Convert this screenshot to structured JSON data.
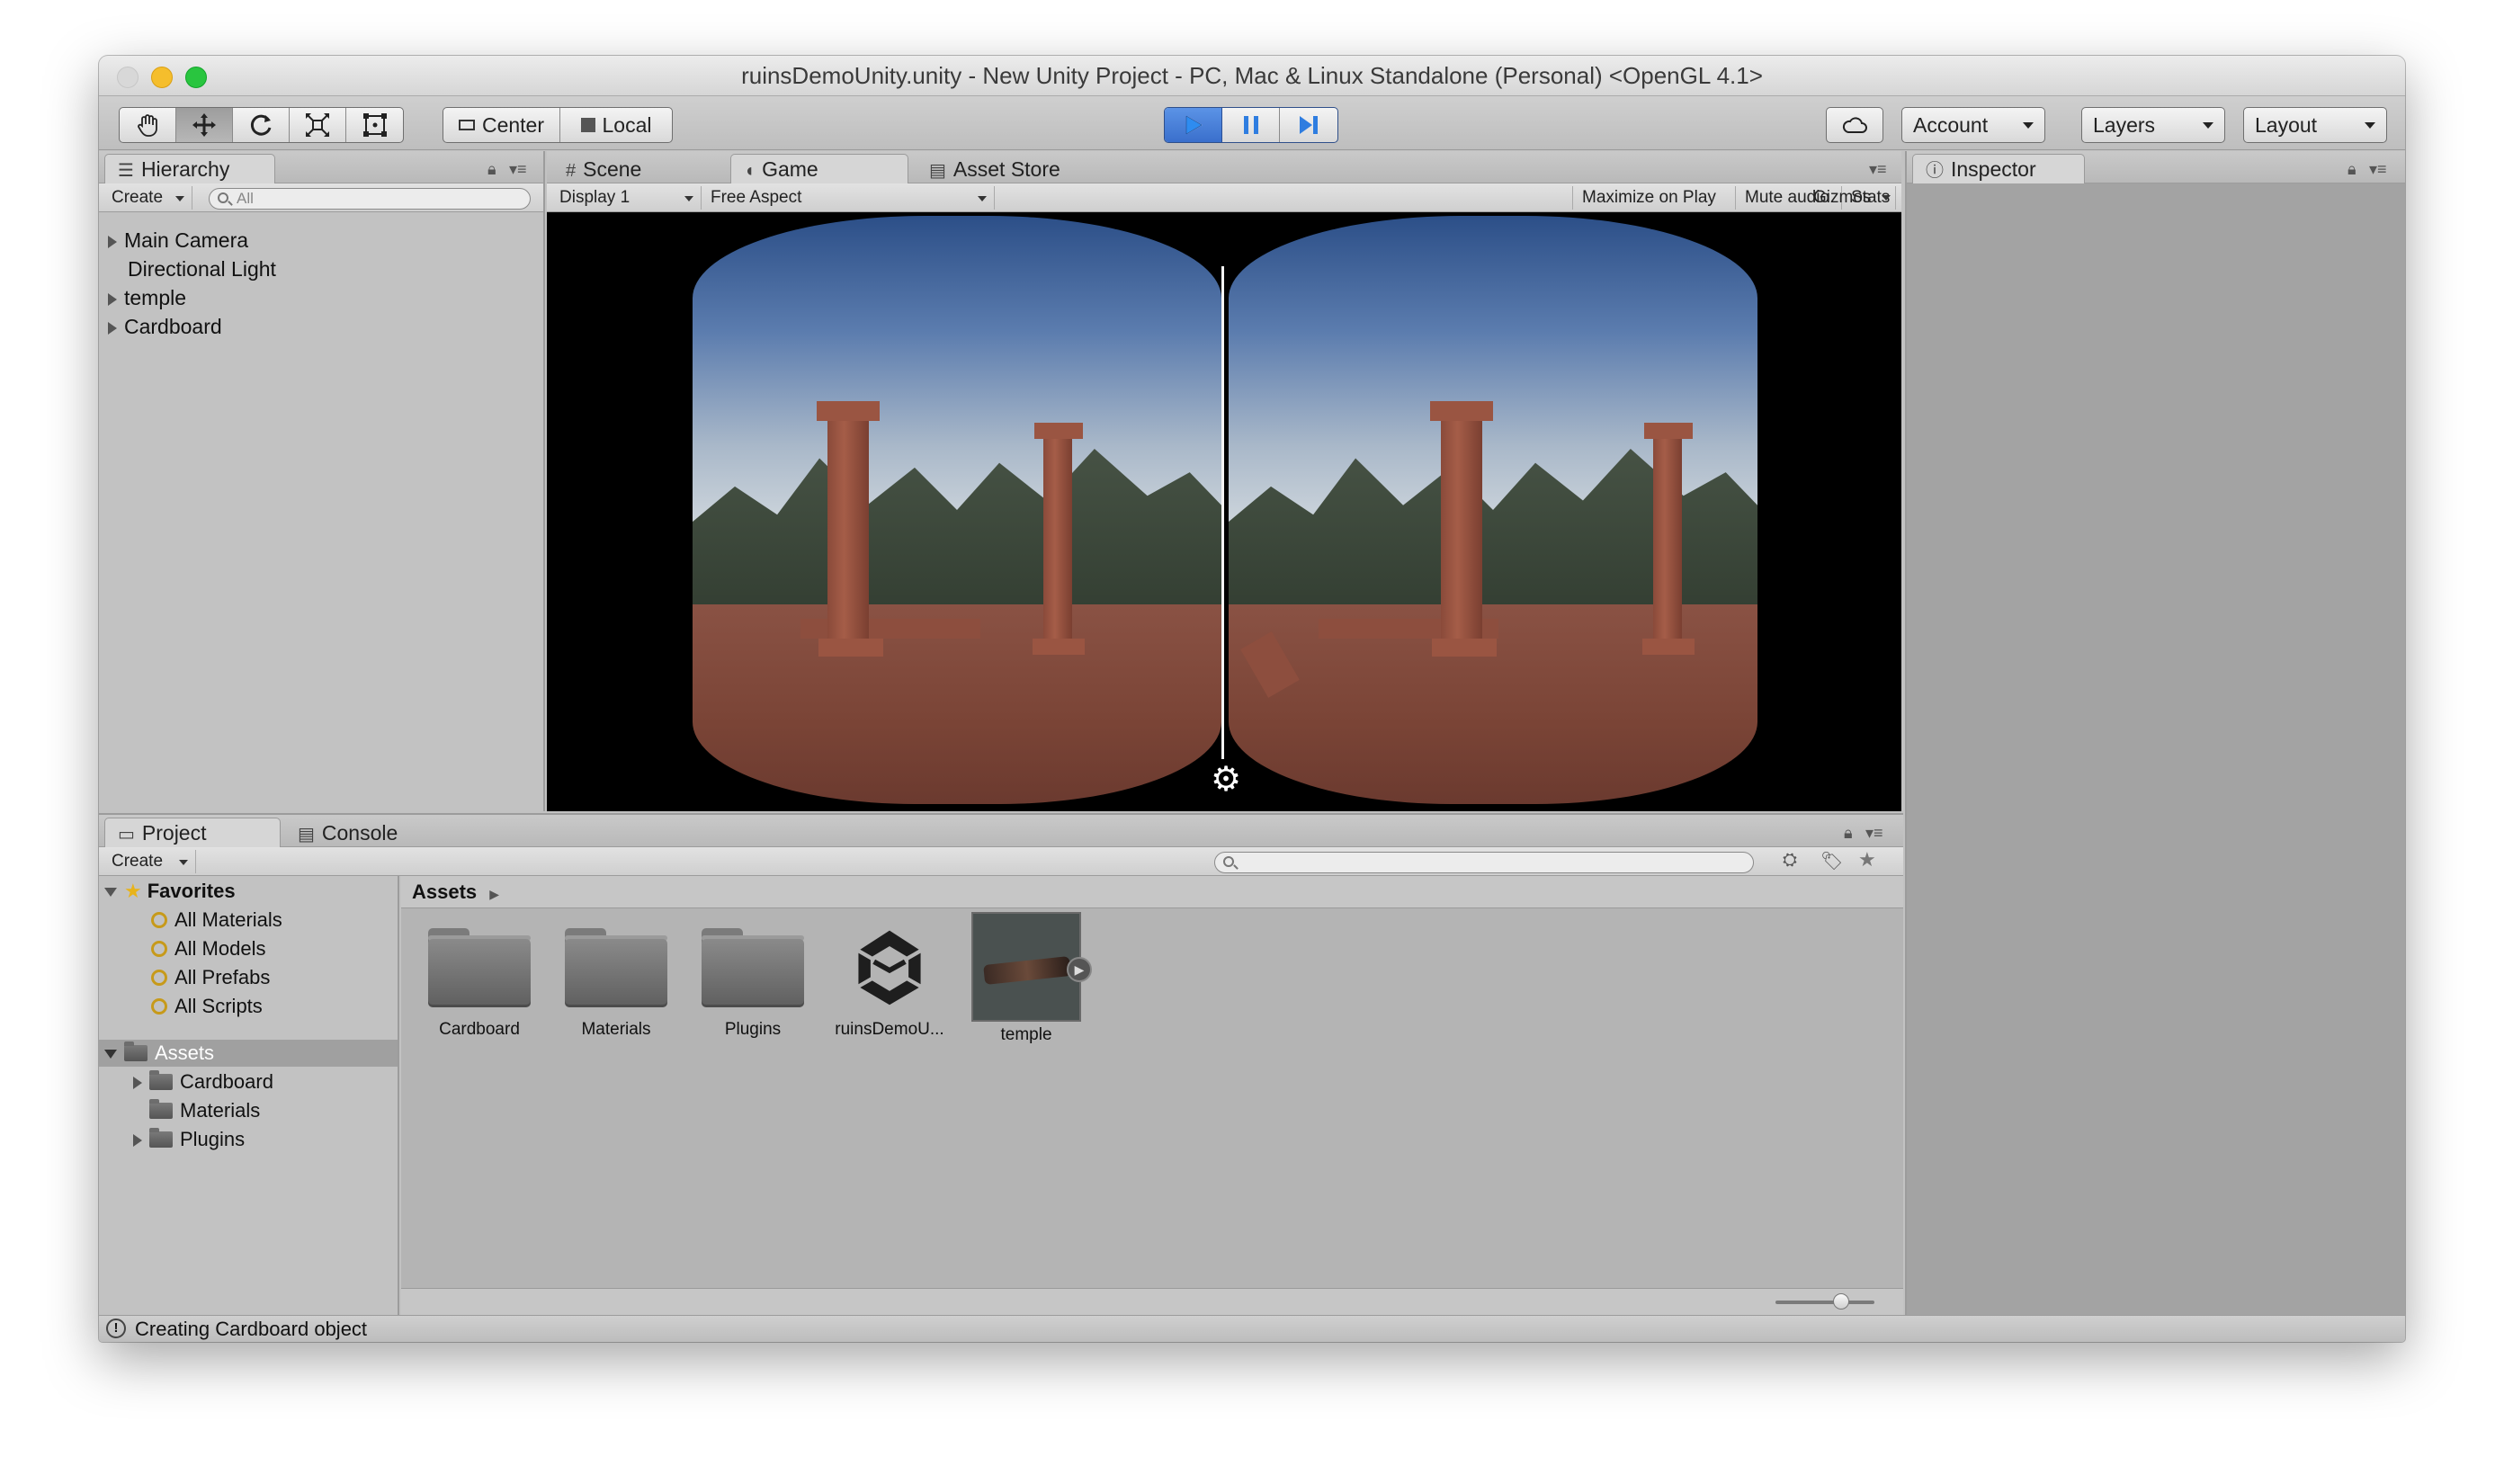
{
  "window": {
    "title": "ruinsDemoUnity.unity - New Unity Project - PC, Mac & Linux Standalone (Personal) <OpenGL 4.1>"
  },
  "toolbar": {
    "tools": [
      "hand-tool",
      "move-tool",
      "rotate-tool",
      "scale-tool",
      "rect-tool"
    ],
    "pivot_label": "Center",
    "space_label": "Local",
    "account_label": "Account",
    "layers_label": "Layers",
    "layout_label": "Layout",
    "colors": {
      "play_active": "#3a6fcc"
    }
  },
  "hierarchy": {
    "tab_label": "Hierarchy",
    "create_label": "Create",
    "search_placeholder": "All",
    "items": [
      {
        "label": "Main Camera",
        "expandable": true
      },
      {
        "label": "Directional Light",
        "expandable": false
      },
      {
        "label": "temple",
        "expandable": true
      },
      {
        "label": "Cardboard",
        "expandable": true
      }
    ]
  },
  "game": {
    "tabs": [
      {
        "label": "Scene",
        "icon": "grid-icon"
      },
      {
        "label": "Game",
        "icon": "pacman-icon"
      },
      {
        "label": "Asset Store",
        "icon": "store-icon"
      }
    ],
    "display_label": "Display 1",
    "aspect_label": "Free Aspect",
    "maximize_label": "Maximize on Play",
    "mute_label": "Mute audio",
    "stats_label": "Stats",
    "gizmos_label": "Gizmos"
  },
  "inspector": {
    "tab_label": "Inspector"
  },
  "project": {
    "tabs": [
      {
        "label": "Project"
      },
      {
        "label": "Console"
      }
    ],
    "create_label": "Create",
    "favorites_label": "Favorites",
    "favorites": [
      "All Materials",
      "All Models",
      "All Prefabs",
      "All Scripts"
    ],
    "assets_root": "Assets",
    "asset_folders": [
      "Cardboard",
      "Materials",
      "Plugins"
    ],
    "breadcrumb": "Assets",
    "assets": [
      {
        "label": "Cardboard",
        "type": "folder"
      },
      {
        "label": "Materials",
        "type": "folder"
      },
      {
        "label": "Plugins",
        "type": "folder"
      },
      {
        "label": "ruinsDemoU...",
        "type": "unity-scene"
      },
      {
        "label": "temple",
        "type": "model"
      }
    ]
  },
  "status": {
    "message": "Creating Cardboard object"
  }
}
